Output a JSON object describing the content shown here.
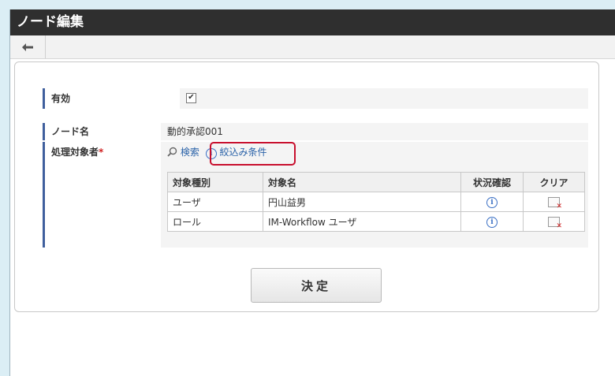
{
  "window": {
    "title": "ノード編集"
  },
  "toolbar": {
    "back_icon": "arrow-left-icon"
  },
  "form": {
    "enabled": {
      "label": "有効",
      "checked": "✔"
    },
    "node_name": {
      "label": "ノード名",
      "value": "動的承認001"
    },
    "processor": {
      "label": "処理対象者",
      "required_mark": "*",
      "search_label": "検索",
      "filter_label": "絞込み条件"
    }
  },
  "table": {
    "headers": [
      "対象種別",
      "対象名",
      "状況確認",
      "クリア"
    ],
    "rows": [
      {
        "type": "ユーザ",
        "name": "円山益男",
        "status_icon": "i"
      },
      {
        "type": "ロール",
        "name": "IM-Workflow ユーザ",
        "status_icon": "i"
      }
    ]
  },
  "actions": {
    "decide_label": "決定"
  },
  "colors": {
    "title_bar": "#2f2f2f",
    "accent": "#3f5f9d",
    "link": "#2a62a8",
    "highlight": "#c8102e"
  }
}
